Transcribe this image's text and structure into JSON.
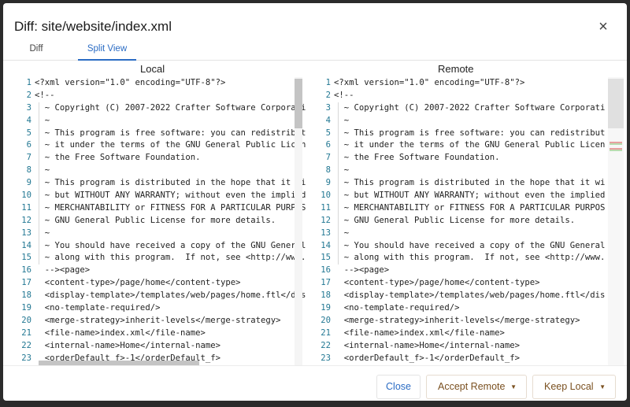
{
  "dialog": {
    "title": "Diff: site/website/index.xml",
    "close_icon": "×"
  },
  "tabs": [
    {
      "label": "Diff",
      "active": false
    },
    {
      "label": "Split View",
      "active": true
    }
  ],
  "panes": {
    "left_title": "Local",
    "right_title": "Remote"
  },
  "left_lines": [
    {
      "n": "1",
      "t": "<?xml version=\"1.0\" encoding=\"UTF-8\"?>"
    },
    {
      "n": "2",
      "t": "<!--"
    },
    {
      "n": "3",
      "t": "  ~ Copyright (C) 2007-2022 Crafter Software Corporati"
    },
    {
      "n": "4",
      "t": "  ~"
    },
    {
      "n": "5",
      "t": "  ~ This program is free software: you can redistribut"
    },
    {
      "n": "6",
      "t": "  ~ it under the terms of the GNU General Public Licen"
    },
    {
      "n": "7",
      "t": "  ~ the Free Software Foundation."
    },
    {
      "n": "8",
      "t": "  ~"
    },
    {
      "n": "9",
      "t": "  ~ This program is distributed in the hope that it wi"
    },
    {
      "n": "10",
      "t": "  ~ but WITHOUT ANY WARRANTY; without even the implied"
    },
    {
      "n": "11",
      "t": "  ~ MERCHANTABILITY or FITNESS FOR A PARTICULAR PURPOS"
    },
    {
      "n": "12",
      "t": "  ~ GNU General Public License for more details."
    },
    {
      "n": "13",
      "t": "  ~"
    },
    {
      "n": "14",
      "t": "  ~ You should have received a copy of the GNU General"
    },
    {
      "n": "15",
      "t": "  ~ along with this program.  If not, see <http://www."
    },
    {
      "n": "16",
      "t": "  --><page>"
    },
    {
      "n": "17",
      "t": "  <content-type>/page/home</content-type>"
    },
    {
      "n": "18",
      "t": "  <display-template>/templates/web/pages/home.ftl</dis"
    },
    {
      "n": "19",
      "t": "  <no-template-required/>"
    },
    {
      "n": "20",
      "t": "  <merge-strategy>inherit-levels</merge-strategy>"
    },
    {
      "n": "21",
      "t": "  <file-name>index.xml</file-name>"
    },
    {
      "n": "22",
      "t": "  <internal-name>Home</internal-name>"
    },
    {
      "n": "23",
      "t": "  <orderDefault_f>-1</orderDefault_f>"
    }
  ],
  "right_lines": [
    {
      "n": "1",
      "t": "<?xml version=\"1.0\" encoding=\"UTF-8\"?>"
    },
    {
      "n": "2",
      "t": "<!--"
    },
    {
      "n": "3",
      "t": "  ~ Copyright (C) 2007-2022 Crafter Software Corporati"
    },
    {
      "n": "4",
      "t": "  ~"
    },
    {
      "n": "5",
      "t": "  ~ This program is free software: you can redistribut"
    },
    {
      "n": "6",
      "t": "  ~ it under the terms of the GNU General Public Licen"
    },
    {
      "n": "7",
      "t": "  ~ the Free Software Foundation."
    },
    {
      "n": "8",
      "t": "  ~"
    },
    {
      "n": "9",
      "t": "  ~ This program is distributed in the hope that it wi"
    },
    {
      "n": "10",
      "t": "  ~ but WITHOUT ANY WARRANTY; without even the implied"
    },
    {
      "n": "11",
      "t": "  ~ MERCHANTABILITY or FITNESS FOR A PARTICULAR PURPOS"
    },
    {
      "n": "12",
      "t": "  ~ GNU General Public License for more details."
    },
    {
      "n": "13",
      "t": "  ~"
    },
    {
      "n": "14",
      "t": "  ~ You should have received a copy of the GNU General"
    },
    {
      "n": "15",
      "t": "  ~ along with this program.  If not, see <http://www."
    },
    {
      "n": "16",
      "t": "  --><page>"
    },
    {
      "n": "17",
      "t": "  <content-type>/page/home</content-type>"
    },
    {
      "n": "18",
      "t": "  <display-template>/templates/web/pages/home.ftl</dis"
    },
    {
      "n": "19",
      "t": "  <no-template-required/>"
    },
    {
      "n": "20",
      "t": "  <merge-strategy>inherit-levels</merge-strategy>"
    },
    {
      "n": "21",
      "t": "  <file-name>index.xml</file-name>"
    },
    {
      "n": "22",
      "t": "  <internal-name>Home</internal-name>"
    },
    {
      "n": "23",
      "t": "  <orderDefault_f>-1</orderDefault_f>"
    }
  ],
  "overview_markers": [
    {
      "type": "removed",
      "color": "#e8a0a0"
    },
    {
      "type": "added",
      "color": "#b8dcb0"
    },
    {
      "type": "removed",
      "color": "#e8a0a0"
    },
    {
      "type": "added",
      "color": "#b8dcb0"
    }
  ],
  "footer": {
    "close_label": "Close",
    "accept_remote_label": "Accept Remote",
    "keep_local_label": "Keep Local",
    "caret_icon": "▼"
  },
  "colors": {
    "accent": "#2b6cc4",
    "action_text": "#7a5020",
    "line_number": "#237893"
  }
}
